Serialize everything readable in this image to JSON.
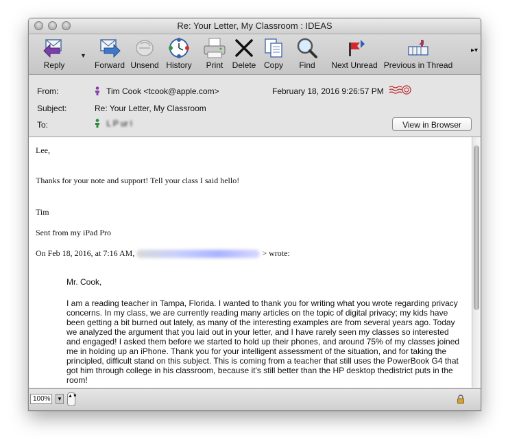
{
  "window": {
    "title": "Re: Your Letter, My Classroom : IDEAS"
  },
  "toolbar": {
    "items": [
      {
        "label": "Reply",
        "icon": "reply-icon"
      },
      {
        "label": "Forward",
        "icon": "forward-icon"
      },
      {
        "label": "Unsend",
        "icon": "unsend-icon"
      },
      {
        "label": "History",
        "icon": "history-icon"
      },
      {
        "label": "Print",
        "icon": "printer-icon"
      },
      {
        "label": "Delete",
        "icon": "delete-x-icon"
      },
      {
        "label": "Copy",
        "icon": "copy-icon"
      },
      {
        "label": "Find",
        "icon": "magnifier-icon"
      },
      {
        "label": "Next Unread",
        "icon": "next-unread-flag-icon"
      },
      {
        "label": "Previous in Thread",
        "icon": "previous-thread-icon"
      }
    ],
    "reply_menu_glyph": "▼",
    "overflow_glyph": "▸▾"
  },
  "header": {
    "from_label": "From:",
    "from_value": "Tim Cook <tcook@apple.com>",
    "date": "February 18, 2016 9:26:57 PM",
    "subject_label": "Subject:",
    "subject_value": "Re: Your Letter, My Classroom",
    "to_label": "To:",
    "to_value": "L   P  ur l",
    "view_in_browser": "View in Browser"
  },
  "message": {
    "salutation": "Lee,",
    "line1": "Thanks for your note and support!  Tell your class I said hello!",
    "signature": "Tim",
    "sent_from": "Sent from my iPad Pro",
    "reply_header_prefix": "On Feb 18, 2016, at 7:16 AM,",
    "reply_header_suffix": "> wrote:",
    "quoted_greeting": "Mr. Cook,",
    "quoted_body": "I am a reading teacher in Tampa, Florida. I wanted to thank you for writing what you wrote regarding privacy concerns. In my class, we are currently reading many articles on the topic of digital privacy; my kids have been getting a bit burned out lately, as many of the interesting examples are from several years ago. Today we analyzed the argument that you laid out in your letter, and I have rarely seen my classes so interested and engaged! I asked them before we started to hold up their phones, and around 75% of my classes joined me in holding up an iPhone. Thank you for your intelligent assessment of the situation, and for taking the principled, difficult stand on this subject. This is coming from a teacher that still uses the PowerBook G4 that got him through college in his classroom, because it's still better than the HP desktop thedistrict puts in the room!"
  },
  "status": {
    "zoom": "100%",
    "zoom_drop_glyph": "▼",
    "zoom_step_glyph": "▲▼"
  },
  "colors": {
    "link": "#2233cc",
    "reply_purple": "#7b3fa8",
    "flag_red": "#d4282d"
  }
}
